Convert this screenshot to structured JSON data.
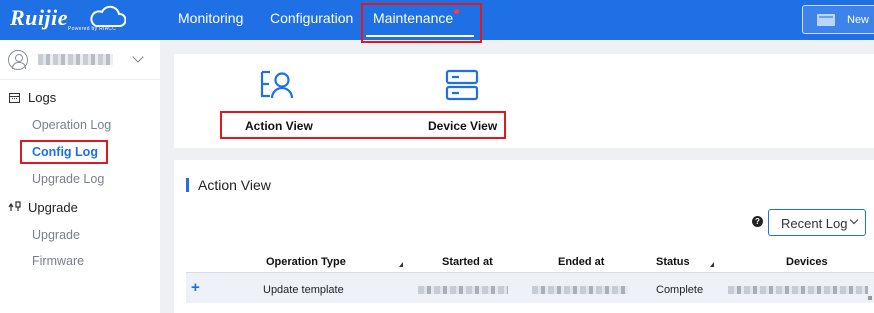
{
  "brand": {
    "name": "Ruijie",
    "tagline": "Powered by RIACC"
  },
  "nav": {
    "items": [
      {
        "label": "Monitoring"
      },
      {
        "label": "Configuration"
      },
      {
        "label": "Maintenance",
        "active": true
      }
    ],
    "new_button": "New"
  },
  "sidebar": {
    "groups": [
      {
        "label": "Logs",
        "icon": "calendar-icon",
        "items": [
          {
            "label": "Operation Log"
          },
          {
            "label": "Config Log",
            "active": true
          },
          {
            "label": "Upgrade Log"
          }
        ]
      },
      {
        "label": "Upgrade",
        "icon": "upgrade-icon",
        "items": [
          {
            "label": "Upgrade"
          },
          {
            "label": "Firmware"
          }
        ]
      }
    ]
  },
  "views": [
    {
      "label": "Action View",
      "icon": "action-view-icon"
    },
    {
      "label": "Device View",
      "icon": "device-view-icon"
    }
  ],
  "section": {
    "title": "Action View",
    "filter": {
      "selected": "Recent Log"
    }
  },
  "table": {
    "columns": [
      "Operation Type",
      "Started at",
      "Ended at",
      "Status",
      "Devices"
    ],
    "rows": [
      {
        "operation_type": "Update template",
        "status": "Complete"
      }
    ]
  },
  "colors": {
    "accent": "#1f6fe5",
    "highlight_box": "#e0191c"
  }
}
